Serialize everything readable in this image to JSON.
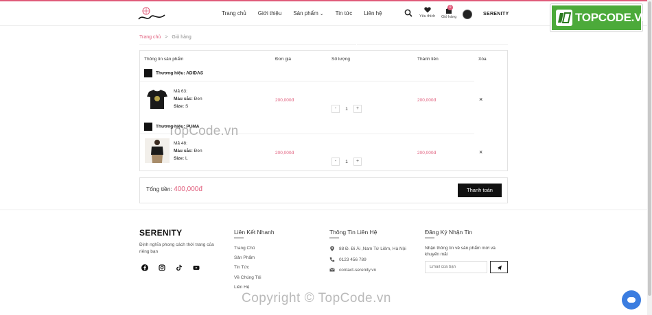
{
  "header": {
    "logo_text": "SERENITY",
    "nav": [
      "Trang chủ",
      "Giới thiệu",
      "Sản phẩm",
      "Tin tức",
      "Liên hệ"
    ],
    "wishlist_label": "Yêu thích",
    "cart_label": "Giỏ hàng",
    "cart_count": "0",
    "user_name": "SERENITY"
  },
  "badge": {
    "text": "TOPCODE.VN"
  },
  "breadcrumb": {
    "home": "Trang chủ",
    "sep": ">",
    "current": "Giỏ hàng"
  },
  "cart": {
    "headers": {
      "product": "Thông tin sản phẩm",
      "price": "Đơn giá",
      "qty": "Số lượng",
      "total": "Thành tiền",
      "delete": "Xóa"
    },
    "groups": [
      {
        "brand": "Thương hiệu: ADIDAS",
        "item": {
          "code": "Mã 63:",
          "color_label": "Màu sắc:",
          "color": "Đen",
          "size_label": "Size:",
          "size": "S",
          "price": "200,000đ",
          "qty": "1",
          "line_total": "200,000đ"
        }
      },
      {
        "brand": "Thương hiệu: PUMA",
        "item": {
          "code": "Mã 48:",
          "color_label": "Màu sắc:",
          "color": "Đen",
          "size_label": "Size:",
          "size": "L",
          "price": "200,000đ",
          "qty": "1",
          "line_total": "200,000đ"
        }
      }
    ],
    "minus": "-",
    "plus": "+",
    "delete_glyph": "×"
  },
  "summary": {
    "total_label": "Tổng tiền:",
    "total_value": "400,000đ",
    "pay_label": "Thanh toán"
  },
  "footer": {
    "brand": "SERENITY",
    "tagline": "Định nghĩa phong cách thời trang của riêng bạn",
    "quicklinks_title": "Liên Kết Nhanh",
    "quicklinks": [
      "Trang Chủ",
      "Sản Phẩm",
      "Tin Tức",
      "Về Chúng Tôi",
      "Liên Hệ"
    ],
    "contact_title": "Thông Tin Liên Hệ",
    "address": "88 Đ. Đi Ái ,Nam Từ Liêm, Hà Nội",
    "phone": "0123 456 789",
    "email": "contact-serenity.vn",
    "newsletter_title": "Đăng Ký Nhận Tin",
    "newsletter_text": "Nhận thông tin về sản phẩm mới và khuyến mãi",
    "email_placeholder": "Email của bạn"
  },
  "watermarks": [
    "TopCode.vn",
    "Copyright © TopCode.vn"
  ],
  "colors": {
    "accent": "#e05b7a",
    "button": "#111111",
    "badge_green": "#4caa3a",
    "chat_blue": "#3b7de0"
  }
}
